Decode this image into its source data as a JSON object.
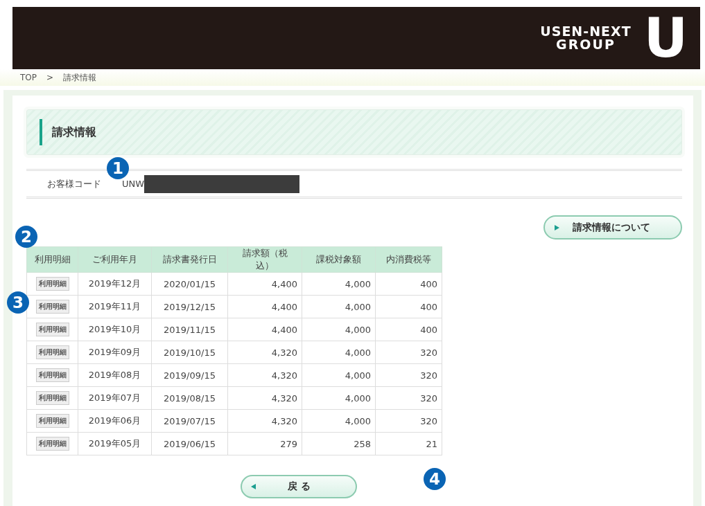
{
  "header": {
    "logo_line1": "USEN-NEXT",
    "logo_line2": "GROUP",
    "logo_mark": "U"
  },
  "breadcrumb": {
    "items": [
      "TOP",
      "請求情報"
    ],
    "separator": ">"
  },
  "page_title": "請求情報",
  "customer": {
    "label": "お客様コード",
    "value": "UNW"
  },
  "info_button": {
    "label": "請求情報について"
  },
  "table": {
    "columns": [
      "利用明細",
      "ご利用年月",
      "請求書発行日",
      "請求額（税込）",
      "課税対象額",
      "内消費税等"
    ],
    "rows": [
      {
        "button": "利用明細",
        "month": "2019年12月",
        "issued": "2020/01/15",
        "amount": "4,400",
        "taxable": "4,000",
        "tax": "400"
      },
      {
        "button": "利用明細",
        "month": "2019年11月",
        "issued": "2019/12/15",
        "amount": "4,400",
        "taxable": "4,000",
        "tax": "400"
      },
      {
        "button": "利用明細",
        "month": "2019年10月",
        "issued": "2019/11/15",
        "amount": "4,400",
        "taxable": "4,000",
        "tax": "400"
      },
      {
        "button": "利用明細",
        "month": "2019年09月",
        "issued": "2019/10/15",
        "amount": "4,320",
        "taxable": "4,000",
        "tax": "320"
      },
      {
        "button": "利用明細",
        "month": "2019年08月",
        "issued": "2019/09/15",
        "amount": "4,320",
        "taxable": "4,000",
        "tax": "320"
      },
      {
        "button": "利用明細",
        "month": "2019年07月",
        "issued": "2019/08/15",
        "amount": "4,320",
        "taxable": "4,000",
        "tax": "320"
      },
      {
        "button": "利用明細",
        "month": "2019年06月",
        "issued": "2019/07/15",
        "amount": "4,320",
        "taxable": "4,000",
        "tax": "320"
      },
      {
        "button": "利用明細",
        "month": "2019年05月",
        "issued": "2019/06/15",
        "amount": "279",
        "taxable": "258",
        "tax": "21"
      }
    ]
  },
  "back_button": {
    "label": "戻 る"
  },
  "callouts": [
    "1",
    "2",
    "3",
    "4"
  ]
}
